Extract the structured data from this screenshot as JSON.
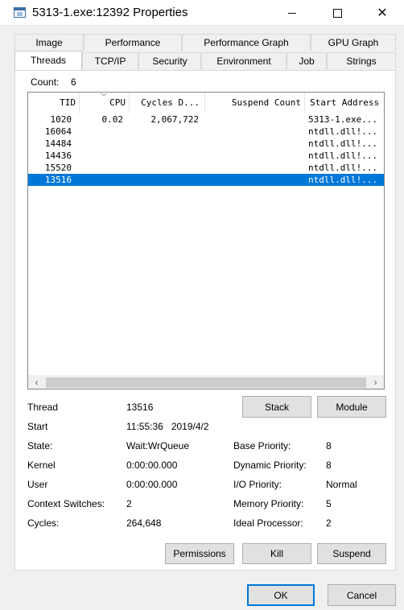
{
  "window": {
    "title": "5313-1.exe:12392 Properties",
    "icon": "window-app-icon",
    "controls": {
      "minimize": "minimize-icon",
      "maximize": "maximize-icon",
      "close": "✕"
    }
  },
  "tabs": {
    "row1": [
      "Image",
      "Performance",
      "Performance Graph",
      "GPU Graph"
    ],
    "row2": [
      "Threads",
      "TCP/IP",
      "Security",
      "Environment",
      "Job",
      "Strings"
    ],
    "active": "Threads"
  },
  "count": {
    "label": "Count:",
    "value": "6"
  },
  "thread_list": {
    "columns": [
      "TID",
      "CPU",
      "Cycles D...",
      "Suspend Count",
      "Start Address"
    ],
    "rows": [
      {
        "tid": "1020",
        "cpu": "0.02",
        "cycles": "2,067,722",
        "suspend": "",
        "start": "5313-1.exe..."
      },
      {
        "tid": "16064",
        "cpu": "",
        "cycles": "",
        "suspend": "",
        "start": "ntdll.dll!..."
      },
      {
        "tid": "14484",
        "cpu": "",
        "cycles": "",
        "suspend": "",
        "start": "ntdll.dll!..."
      },
      {
        "tid": "14436",
        "cpu": "",
        "cycles": "",
        "suspend": "",
        "start": "ntdll.dll!..."
      },
      {
        "tid": "15520",
        "cpu": "",
        "cycles": "",
        "suspend": "",
        "start": "ntdll.dll!..."
      },
      {
        "tid": "13516",
        "cpu": "",
        "cycles": "",
        "suspend": "",
        "start": "ntdll.dll!..."
      }
    ],
    "selected_tid": "13516",
    "scroll_left": "‹",
    "scroll_right": "›"
  },
  "details": {
    "thread_label": "Thread",
    "thread_value": "13516",
    "start_label": "Start",
    "start_value": "11:55:36   2019/4/2",
    "state_label": "State:",
    "state_value": "Wait:WrQueue",
    "kernel_label": "Kernel",
    "kernel_value": "0:00:00.000",
    "user_label": "User",
    "user_value": "0:00:00.000",
    "ctx_label": "Context Switches:",
    "ctx_value": "2",
    "cycles_label": "Cycles:",
    "cycles_value": "264,648",
    "base_priority_label": "Base Priority:",
    "base_priority_value": "8",
    "dynamic_priority_label": "Dynamic Priority:",
    "dynamic_priority_value": "8",
    "io_priority_label": "I/O Priority:",
    "io_priority_value": "Normal",
    "memory_priority_label": "Memory Priority:",
    "memory_priority_value": "5",
    "ideal_processor_label": "Ideal Processor:",
    "ideal_processor_value": "2"
  },
  "buttons": {
    "stack": "Stack",
    "module": "Module",
    "permissions": "Permissions",
    "kill": "Kill",
    "suspend": "Suspend",
    "ok": "OK",
    "cancel": "Cancel"
  },
  "colors": {
    "selection": "#0078d7",
    "default_button_border": "#0078d7"
  }
}
